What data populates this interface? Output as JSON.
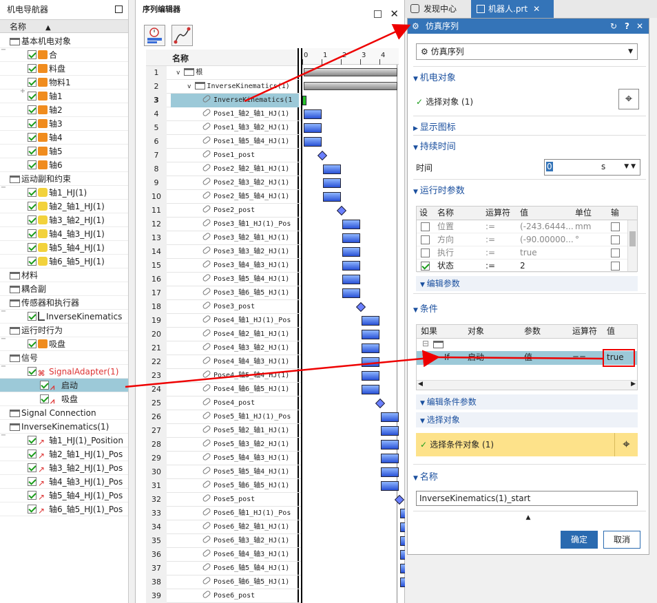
{
  "navigator": {
    "title": "机电导航器",
    "header": "名称",
    "items": [
      {
        "label": "基本机电对象",
        "level": 0,
        "type": "folder",
        "expander": "−"
      },
      {
        "label": "合",
        "level": 1,
        "type": "cube"
      },
      {
        "label": "料盘",
        "level": 1,
        "type": "cube"
      },
      {
        "label": "物料1",
        "level": 1,
        "type": "cube",
        "expander": "+"
      },
      {
        "label": "轴1",
        "level": 1,
        "type": "cube"
      },
      {
        "label": "轴2",
        "level": 1,
        "type": "cube"
      },
      {
        "label": "轴3",
        "level": 1,
        "type": "cube"
      },
      {
        "label": "轴4",
        "level": 1,
        "type": "cube"
      },
      {
        "label": "轴5",
        "level": 1,
        "type": "cube"
      },
      {
        "label": "轴6",
        "level": 1,
        "type": "cube"
      },
      {
        "label": "运动副和约束",
        "level": 0,
        "type": "folder",
        "expander": "−"
      },
      {
        "label": "轴1_HJ(1)",
        "level": 1,
        "type": "joint"
      },
      {
        "label": "轴2_轴1_HJ(1)",
        "level": 1,
        "type": "joint"
      },
      {
        "label": "轴3_轴2_HJ(1)",
        "level": 1,
        "type": "joint"
      },
      {
        "label": "轴4_轴3_HJ(1)",
        "level": 1,
        "type": "joint"
      },
      {
        "label": "轴5_轴4_HJ(1)",
        "level": 1,
        "type": "joint"
      },
      {
        "label": "轴6_轴5_HJ(1)",
        "level": 1,
        "type": "joint"
      },
      {
        "label": "材料",
        "level": 0,
        "type": "folder"
      },
      {
        "label": "耦合副",
        "level": 0,
        "type": "folder"
      },
      {
        "label": "传感器和执行器",
        "level": 0,
        "type": "folder",
        "expander": "−"
      },
      {
        "label": "InverseKinematics",
        "level": 1,
        "type": "sensor"
      },
      {
        "label": "运行时行为",
        "level": 0,
        "type": "folder",
        "expander": "−"
      },
      {
        "label": "吸盘",
        "level": 1,
        "type": "cube"
      },
      {
        "label": "信号",
        "level": 0,
        "type": "folder",
        "expander": "−"
      },
      {
        "label": "SignalAdapter(1)",
        "level": 1,
        "type": "sig",
        "red": true,
        "expander": "−"
      },
      {
        "label": "启动",
        "level": 2,
        "type": "wave",
        "selected": true
      },
      {
        "label": "吸盘",
        "level": 2,
        "type": "wave"
      },
      {
        "label": "Signal Connection",
        "level": 0,
        "type": "folder"
      },
      {
        "label": "InverseKinematics(1)",
        "level": 0,
        "type": "folder",
        "expander": "−"
      },
      {
        "label": "轴1_HJ(1)_Position",
        "level": 1,
        "type": "pos"
      },
      {
        "label": "轴2_轴1_HJ(1)_Pos",
        "level": 1,
        "type": "pos"
      },
      {
        "label": "轴3_轴2_HJ(1)_Pos",
        "level": 1,
        "type": "pos"
      },
      {
        "label": "轴4_轴3_HJ(1)_Pos",
        "level": 1,
        "type": "pos"
      },
      {
        "label": "轴5_轴4_HJ(1)_Pos",
        "level": 1,
        "type": "pos"
      },
      {
        "label": "轴6_轴5_HJ(1)_Pos",
        "level": 1,
        "type": "pos"
      }
    ]
  },
  "sequence_editor": {
    "title": "序列编辑器",
    "col_name": "名称",
    "ticks": [
      "0",
      "1",
      "2",
      "3",
      "4"
    ],
    "rows": [
      {
        "n": "1",
        "label": "根",
        "kind": "folder"
      },
      {
        "n": "2",
        "label": "InverseKinematics(1)",
        "kind": "folder"
      },
      {
        "n": "3",
        "label": "InverseKinematics(1",
        "kind": "link",
        "selected": true
      },
      {
        "n": "4",
        "label": "Pose1_轴2_轴1_HJ(1)",
        "kind": "link"
      },
      {
        "n": "5",
        "label": "Pose1_轴3_轴2_HJ(1)",
        "kind": "link"
      },
      {
        "n": "6",
        "label": "Pose1_轴5_轴4_HJ(1)",
        "kind": "link"
      },
      {
        "n": "7",
        "label": "Pose1_post",
        "kind": "link"
      },
      {
        "n": "8",
        "label": "Pose2_轴2_轴1_HJ(1)",
        "kind": "link"
      },
      {
        "n": "9",
        "label": "Pose2_轴3_轴2_HJ(1)",
        "kind": "link"
      },
      {
        "n": "10",
        "label": "Pose2_轴5_轴4_HJ(1)",
        "kind": "link"
      },
      {
        "n": "11",
        "label": "Pose2_post",
        "kind": "link"
      },
      {
        "n": "12",
        "label": "Pose3_轴1_HJ(1)_Pos",
        "kind": "link"
      },
      {
        "n": "13",
        "label": "Pose3_轴2_轴1_HJ(1)",
        "kind": "link"
      },
      {
        "n": "14",
        "label": "Pose3_轴3_轴2_HJ(1)",
        "kind": "link"
      },
      {
        "n": "15",
        "label": "Pose3_轴4_轴3_HJ(1)",
        "kind": "link"
      },
      {
        "n": "16",
        "label": "Pose3_轴5_轴4_HJ(1)",
        "kind": "link"
      },
      {
        "n": "17",
        "label": "Pose3_轴6_轴5_HJ(1)",
        "kind": "link"
      },
      {
        "n": "18",
        "label": "Pose3_post",
        "kind": "link"
      },
      {
        "n": "19",
        "label": "Pose4_轴1_HJ(1)_Pos",
        "kind": "link"
      },
      {
        "n": "20",
        "label": "Pose4_轴2_轴1_HJ(1)",
        "kind": "link"
      },
      {
        "n": "21",
        "label": "Pose4_轴3_轴2_HJ(1)",
        "kind": "link"
      },
      {
        "n": "22",
        "label": "Pose4_轴4_轴3_HJ(1)",
        "kind": "link"
      },
      {
        "n": "23",
        "label": "Pose4_轴5_轴4_HJ(1)",
        "kind": "link"
      },
      {
        "n": "24",
        "label": "Pose4_轴6_轴5_HJ(1)",
        "kind": "link"
      },
      {
        "n": "25",
        "label": "Pose4_post",
        "kind": "link"
      },
      {
        "n": "26",
        "label": "Pose5_轴1_HJ(1)_Pos",
        "kind": "link"
      },
      {
        "n": "27",
        "label": "Pose5_轴2_轴1_HJ(1)",
        "kind": "link"
      },
      {
        "n": "28",
        "label": "Pose5_轴3_轴2_HJ(1)",
        "kind": "link"
      },
      {
        "n": "29",
        "label": "Pose5_轴4_轴3_HJ(1)",
        "kind": "link"
      },
      {
        "n": "30",
        "label": "Pose5_轴5_轴4_HJ(1)",
        "kind": "link"
      },
      {
        "n": "31",
        "label": "Pose5_轴6_轴5_HJ(1)",
        "kind": "link"
      },
      {
        "n": "32",
        "label": "Pose5_post",
        "kind": "link"
      },
      {
        "n": "33",
        "label": "Pose6_轴1_HJ(1)_Pos",
        "kind": "link"
      },
      {
        "n": "34",
        "label": "Pose6_轴2_轴1_HJ(1)",
        "kind": "link"
      },
      {
        "n": "35",
        "label": "Pose6_轴3_轴2_HJ(1)",
        "kind": "link"
      },
      {
        "n": "36",
        "label": "Pose6_轴4_轴3_HJ(1)",
        "kind": "link"
      },
      {
        "n": "37",
        "label": "Pose6_轴5_轴4_HJ(1)",
        "kind": "link"
      },
      {
        "n": "38",
        "label": "Pose6_轴6_轴5_HJ(1)",
        "kind": "link"
      },
      {
        "n": "39",
        "label": "Pose6_post",
        "kind": "link"
      }
    ]
  },
  "tabs": {
    "discover": "发现中心",
    "robot": "机器人.prt"
  },
  "dialog": {
    "title": "仿真序列",
    "type_value": "仿真序列",
    "sec_mech": "机电对象",
    "select_obj": "选择对象 (1)",
    "sec_icon": "显示图标",
    "sec_duration": "持续时间",
    "time_label": "时间",
    "time_value": "0",
    "time_unit": "s",
    "sec_runtime": "运行时参数",
    "rt_headers": [
      "设",
      "名称",
      "运算符",
      "值",
      "单位",
      "输"
    ],
    "rt_rows": [
      {
        "name": "位置",
        "op": ":=",
        "val": "(-243.6444...",
        "unit": "mm",
        "checked": false,
        "gray": true
      },
      {
        "name": "方向",
        "op": ":=",
        "val": "(-90.00000...",
        "unit": "°",
        "checked": false,
        "gray": true
      },
      {
        "name": "执行",
        "op": ":=",
        "val": "true",
        "unit": "",
        "checked": false,
        "gray": true
      },
      {
        "name": "状态",
        "op": ":=",
        "val": "2",
        "unit": "",
        "checked": true,
        "gray": false
      }
    ],
    "edit_params": "编辑参数",
    "sec_cond": "条件",
    "cond_headers": [
      "如果",
      "对象",
      "参数",
      "运算符",
      "值"
    ],
    "cond_row": {
      "if": "If",
      "obj": "启动",
      "param": "值",
      "op": "==",
      "val": "true"
    },
    "edit_cond_params": "编辑条件参数",
    "sel_obj_sec": "选择对象",
    "sel_cond_obj": "选择条件对象 (1)",
    "sec_name": "名称",
    "name_value": "InverseKinematics(1)_start",
    "ok": "确定",
    "cancel": "取消"
  }
}
